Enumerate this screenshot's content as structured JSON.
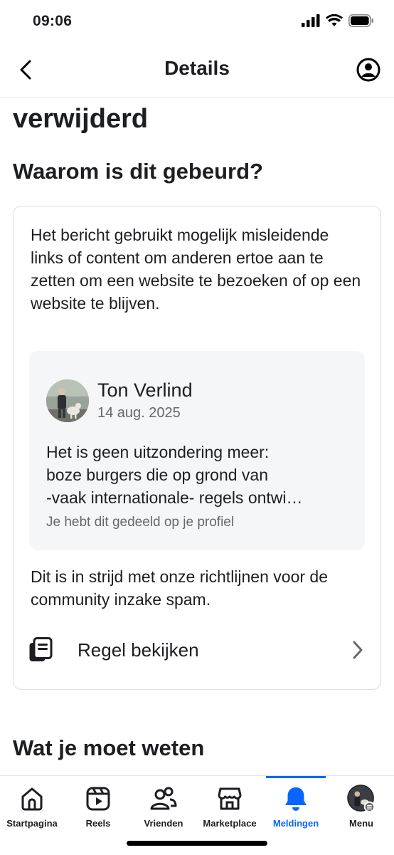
{
  "status_bar": {
    "time": "09:06"
  },
  "nav": {
    "title": "Details"
  },
  "content": {
    "partial_heading": "verwijderd",
    "why_heading": "Waarom is dit gebeurd?",
    "reason_text": "Het bericht gebruikt mogelijk misleidende links of content om anderen ertoe aan te zetten om een website te bezoeken of op een website te blijven.",
    "post": {
      "author": "Ton Verlind",
      "date": "14 aug. 2025",
      "excerpt_lines": [
        "Het is geen uitzondering meer:",
        "boze burgers die op grond van",
        "-vaak internationale- regels ontwi…"
      ],
      "shared_note": "Je hebt dit gedeeld op je profiel"
    },
    "violation_text": "Dit is in strijd met onze richtlijnen voor de community inzake spam.",
    "rule_link": "Regel bekijken",
    "know_heading": "Wat je moet weten"
  },
  "tabs": [
    {
      "label": "Startpagina",
      "icon": "home-icon"
    },
    {
      "label": "Reels",
      "icon": "reels-icon"
    },
    {
      "label": "Vrienden",
      "icon": "friends-icon"
    },
    {
      "label": "Marketplace",
      "icon": "marketplace-icon"
    },
    {
      "label": "Meldingen",
      "icon": "bell-icon",
      "active": true
    },
    {
      "label": "Menu",
      "icon": "profile-menu-icon"
    }
  ],
  "colors": {
    "accent": "#0866ff",
    "text": "#1c1e21",
    "secondary_text": "#65676b",
    "preview_bg": "#f5f6f7"
  }
}
